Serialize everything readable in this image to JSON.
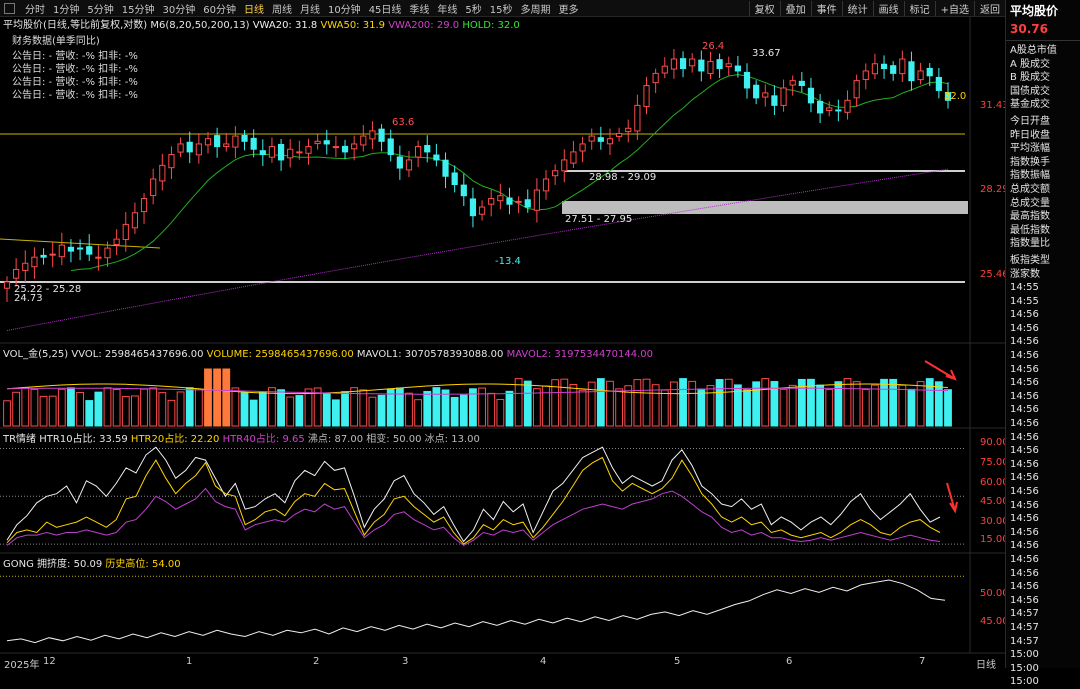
{
  "periods": [
    "分时",
    "1分钟",
    "5分钟",
    "15分钟",
    "30分钟",
    "60分钟",
    "日线",
    "周线",
    "月线",
    "10分钟",
    "45日线",
    "季线",
    "年线",
    "5秒",
    "15秒",
    "多周期",
    "更多"
  ],
  "active_period": "日线",
  "toolbar": [
    "复权",
    "叠加",
    "事件",
    "统计",
    "画线",
    "标记",
    "+自选",
    "返回"
  ],
  "main_header": {
    "name": "平均股价(日线,等比前复权,对数)",
    "ma": "M6(8,20,50,200,13)",
    "vwa20": "VWA20: 31.8",
    "vwa50": "VWA50: 31.9",
    "vwa200": "VWA200: 29.0",
    "hold": "HOLD: 32.0"
  },
  "finance": {
    "title": "财务数据(单季同比)",
    "rows": [
      "公告日: -    营收: -%    扣非: -%",
      "公告日: -    营收: -%    扣非: -%",
      "公告日: -    营收: -%    扣非: -%",
      "公告日: -    营收: -%    扣非: -%"
    ]
  },
  "annotations": [
    "26.4",
    "33.67",
    "63.6",
    "32.0",
    "28.98 - 29.09",
    "27.51 - 27.95",
    "-13.4",
    "25.22 - 25.28",
    "24.73"
  ],
  "price_axis": [
    "31.43",
    "28.29",
    "25.46"
  ],
  "volume_header": {
    "name": "VOL_金(5,25)",
    "vvol": "VVOL: 2598465437696.00",
    "volume": "VOLUME: 2598465437696.00",
    "mavol1": "MAVOL1: 3070578393088.00",
    "mavol2": "MAVOL2: 3197534470144.00"
  },
  "tr_header": {
    "name": "TR情绪",
    "htr10": "HTR10占比: 33.59",
    "htr20": "HTR20占比: 22.20",
    "htr40": "HTR40占比: 9.65",
    "boil": "沸点: 87.00",
    "mid": "相变: 50.00",
    "freeze": "冰点: 13.00"
  },
  "tr_axis": [
    "90.00",
    "75.00",
    "60.00",
    "45.00",
    "30.00",
    "15.00"
  ],
  "gong_header": {
    "name": "GONG",
    "crowd": "拥挤度: 50.09",
    "hist": "历史高位: 54.00"
  },
  "gong_axis": [
    "50.00",
    "45.00"
  ],
  "date_axis": [
    "2025年",
    "12",
    "1",
    "2",
    "3",
    "4",
    "5",
    "6",
    "7"
  ],
  "date_axis_right": "日线",
  "right_panel": {
    "title": "平均股价",
    "price": "30.76",
    "items": [
      "A股总市值",
      "A 股成交",
      "B 股成交",
      "国债成交",
      "基金成交",
      "今日开盘",
      "昨日收盘",
      "平均涨幅",
      "指数换手",
      "指数振幅",
      "总成交额",
      "总成交量",
      "最高指数",
      "最低指数",
      "指数量比",
      "板指类型",
      "涨家数"
    ],
    "times": [
      "14:55",
      "14:55",
      "14:56",
      "14:56",
      "14:56",
      "14:56",
      "14:56",
      "14:56",
      "14:56",
      "14:56",
      "14:56",
      "14:56",
      "14:56",
      "14:56",
      "14:56",
      "14:56",
      "14:56",
      "14:56",
      "14:56",
      "14:56",
      "14:56",
      "14:56",
      "14:56",
      "14:56",
      "14:57",
      "14:57",
      "14:57",
      "15:00",
      "15:00",
      "15:00"
    ]
  },
  "colors": {
    "up": "#ff4a4a",
    "down": "#3ff0f0",
    "vwa20": "#f0f0f0",
    "vwa50": "#ffd400",
    "vwa200": "#d040d0",
    "hold": "#32e632",
    "green_line": "#20b020",
    "yellow_line": "#c8b400",
    "magenta_line": "#b030c8"
  },
  "chart_data": [
    {
      "type": "candlestick",
      "title": "平均股价(日线,等比前复权,对数)",
      "ylim": [
        24.5,
        34.2
      ],
      "ticks": [
        31.43,
        28.29,
        25.46
      ],
      "closes": [
        25.1,
        25.5,
        25.7,
        25.9,
        25.9,
        26.0,
        26.3,
        26.1,
        26.2,
        26.0,
        25.9,
        26.2,
        26.5,
        27.0,
        27.4,
        27.9,
        28.6,
        29.1,
        29.5,
        29.9,
        29.6,
        29.9,
        30.1,
        29.8,
        29.9,
        30.2,
        30.0,
        29.7,
        29.5,
        29.8,
        29.3,
        29.7,
        29.6,
        29.8,
        30.0,
        29.9,
        29.8,
        29.6,
        29.9,
        30.2,
        30.4,
        30.0,
        29.5,
        29.0,
        29.3,
        29.8,
        29.6,
        29.3,
        28.7,
        28.4,
        28.0,
        27.3,
        27.6,
        27.9,
        28.0,
        27.7,
        27.8,
        27.6,
        28.2,
        28.6,
        28.9,
        29.3,
        29.6,
        29.9,
        30.2,
        30.0,
        30.1,
        30.3,
        30.5,
        31.4,
        32.2,
        32.7,
        33.0,
        33.3,
        32.9,
        33.3,
        32.8,
        33.2,
        32.9,
        33.1,
        32.8,
        32.1,
        31.7,
        31.9,
        31.4,
        32.1,
        32.4,
        32.2,
        31.5,
        31.1,
        31.3,
        31.2,
        31.6,
        32.4,
        32.8,
        33.1,
        32.9,
        32.7,
        33.3,
        32.4,
        32.8,
        32.6,
        32.0,
        31.6
      ]
    },
    {
      "type": "bar",
      "title": "VOL_金(5,25)",
      "mavol1": 3070578393088.0,
      "mavol2": 3197534470144.0
    },
    {
      "type": "line",
      "title": "TR情绪",
      "ylim": [
        10,
        92
      ],
      "ticks": [
        90,
        75,
        60,
        45,
        30,
        15
      ],
      "reference": [
        87,
        50,
        13
      ],
      "series": [
        {
          "name": "HTR10",
          "values": [
            16,
            28,
            35,
            45,
            50,
            52,
            58,
            45,
            62,
            58,
            50,
            60,
            72,
            68,
            82,
            88,
            78,
            64,
            70,
            80,
            78,
            64,
            50,
            60,
            40,
            42,
            48,
            52,
            45,
            62,
            70,
            66,
            77,
            70,
            72,
            50,
            26,
            40,
            48,
            62,
            66,
            52,
            45,
            36,
            42,
            28,
            15,
            24,
            40,
            32,
            46,
            38,
            44,
            22,
            38,
            54,
            60,
            70,
            80,
            84,
            88,
            72,
            60,
            66,
            62,
            58,
            62,
            78,
            86,
            74,
            58,
            52,
            44,
            42,
            48,
            40,
            44,
            28,
            34,
            30,
            24,
            30,
            34,
            28,
            36,
            46,
            52,
            40,
            32,
            38,
            44,
            52,
            40,
            30,
            34
          ]
        },
        {
          "name": "HTR20",
          "values": [
            14,
            22,
            24,
            22,
            30,
            26,
            28,
            30,
            34,
            30,
            26,
            32,
            48,
            50,
            66,
            78,
            64,
            52,
            60,
            66,
            76,
            58,
            52,
            50,
            28,
            32,
            38,
            40,
            35,
            46,
            52,
            50,
            60,
            55,
            56,
            38,
            20,
            30,
            36,
            48,
            50,
            42,
            36,
            30,
            34,
            22,
            13,
            18,
            28,
            24,
            32,
            28,
            30,
            18,
            26,
            36,
            46,
            58,
            70,
            76,
            80,
            62,
            54,
            60,
            56,
            52,
            56,
            64,
            78,
            66,
            52,
            44,
            34,
            30,
            34,
            28,
            30,
            22,
            24,
            20,
            18,
            20,
            22,
            18,
            22,
            28,
            32,
            28,
            22,
            20,
            26,
            30,
            32,
            26,
            22
          ]
        },
        {
          "name": "HTR40",
          "values": [
            12,
            18,
            20,
            20,
            22,
            20,
            22,
            22,
            24,
            22,
            20,
            22,
            30,
            32,
            40,
            50,
            46,
            40,
            44,
            48,
            56,
            46,
            42,
            40,
            24,
            28,
            30,
            32,
            30,
            36,
            40,
            38,
            44,
            40,
            42,
            30,
            18,
            24,
            28,
            36,
            38,
            32,
            28,
            24,
            26,
            18,
            12,
            16,
            22,
            20,
            24,
            22,
            24,
            16,
            22,
            28,
            32,
            36,
            40,
            42,
            44,
            42,
            40,
            44,
            46,
            48,
            52,
            54,
            50,
            44,
            38,
            34,
            26,
            22,
            24,
            20,
            22,
            18,
            18,
            16,
            15,
            16,
            18,
            16,
            18,
            20,
            22,
            20,
            18,
            16,
            18,
            20,
            18,
            16,
            15
          ]
        }
      ]
    },
    {
      "type": "line",
      "title": "GONG",
      "ylim": [
        42,
        56
      ],
      "ticks": [
        50,
        45
      ],
      "reference": [
        54
      ],
      "series": [
        {
          "name": "拥挤度",
          "values": [
            43.5,
            43.8,
            43.2,
            44.0,
            43.5,
            44.2,
            43.6,
            44.4,
            43.8,
            44.6,
            44.0,
            44.8,
            44.2,
            45.0,
            44.4,
            45.2,
            44.6,
            44.2,
            45.0,
            44.4,
            45.2,
            44.8,
            45.4,
            44.6,
            45.6,
            45.0,
            45.8,
            45.2,
            46.0,
            45.4,
            46.2,
            45.6,
            46.4,
            45.8,
            46.6,
            46.0,
            46.8,
            46.2,
            47.0,
            46.4,
            47.2,
            46.6,
            47.4,
            46.8,
            47.6,
            47.0,
            47.8,
            48.2,
            47.6,
            48.4,
            47.8,
            48.6,
            49.4,
            50.0,
            51.0,
            51.8,
            51.2,
            52.0,
            51.4,
            52.2,
            51.6,
            52.6,
            53.0,
            53.4,
            52.8,
            51.8,
            50.4,
            50.09
          ]
        }
      ]
    }
  ]
}
